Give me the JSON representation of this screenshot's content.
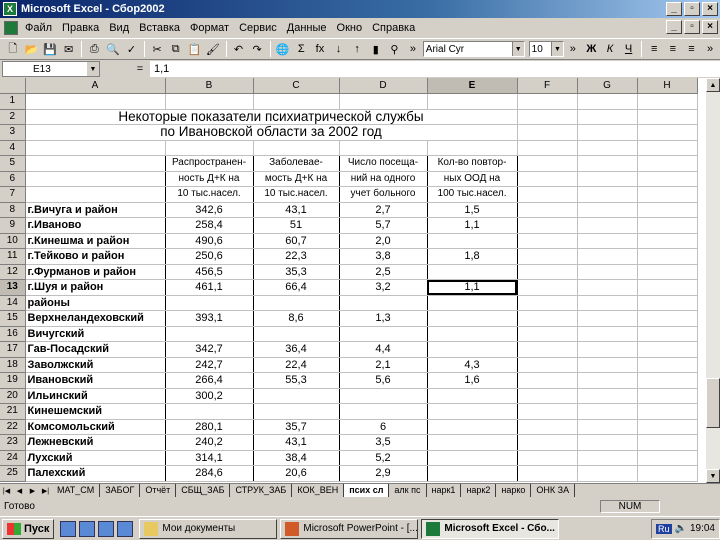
{
  "window": {
    "title": "Microsoft Excel - Сбор2002"
  },
  "menu": [
    "Файл",
    "Правка",
    "Вид",
    "Вставка",
    "Формат",
    "Сервис",
    "Данные",
    "Окно",
    "Справка"
  ],
  "toolbar": {
    "font_name": "Arial Cyr",
    "font_size": "10",
    "bold": "Ж",
    "italic": "К",
    "underline": "Ч",
    "sum": "Σ",
    "fx": "fx"
  },
  "formula_bar": {
    "cell_ref": "E13",
    "equals": "=",
    "value": "1,1"
  },
  "columns": [
    "A",
    "B",
    "C",
    "D",
    "E",
    "F",
    "G",
    "H"
  ],
  "sheet": {
    "title_line1": "Некоторые показатели психиатрической службы",
    "title_line2": "по Ивановской области за 2002 год",
    "headers": {
      "b": [
        "Распространен-",
        "ность Д+К на",
        "10 тыс.насел."
      ],
      "c": [
        "Заболевае-",
        "мость Д+К на",
        "10 тыс.насел."
      ],
      "d": [
        "Число посеща-",
        "ний на одного",
        "учет больного"
      ],
      "e": [
        "Кол-во повтор-",
        "ных ООД на",
        "100 тыс.насел."
      ]
    },
    "rows": [
      {
        "n": "8",
        "a": "г.Вичуга и район",
        "b": "342,6",
        "c": "43,1",
        "d": "2,7",
        "e": "1,5"
      },
      {
        "n": "9",
        "a": "г.Иваново",
        "b": "258,4",
        "c": "51",
        "d": "5,7",
        "e": "1,1"
      },
      {
        "n": "10",
        "a": "г.Кинешма и район",
        "b": "490,6",
        "c": "60,7",
        "d": "2,0",
        "e": ""
      },
      {
        "n": "11",
        "a": "г.Тейково и район",
        "b": "250,6",
        "c": "22,3",
        "d": "3,8",
        "e": "1,8"
      },
      {
        "n": "12",
        "a": "г.Фурманов и район",
        "b": "456,5",
        "c": "35,3",
        "d": "2,5",
        "e": ""
      },
      {
        "n": "13",
        "a": "г.Шуя и район",
        "b": "461,1",
        "c": "66,4",
        "d": "3,2",
        "e": "1,1"
      },
      {
        "n": "14",
        "a": "   районы",
        "b": "",
        "c": "",
        "d": "",
        "e": ""
      },
      {
        "n": "15",
        "a": "Верхнеландеховский",
        "b": "393,1",
        "c": "8,6",
        "d": "1,3",
        "e": ""
      },
      {
        "n": "16",
        "a": "Вичугский",
        "b": "",
        "c": "",
        "d": "",
        "e": ""
      },
      {
        "n": "17",
        "a": "Гав-Посадский",
        "b": "342,7",
        "c": "36,4",
        "d": "4,4",
        "e": ""
      },
      {
        "n": "18",
        "a": "Заволжский",
        "b": "242,7",
        "c": "22,4",
        "d": "2,1",
        "e": "4,3"
      },
      {
        "n": "19",
        "a": "Ивановский",
        "b": "266,4",
        "c": "55,3",
        "d": "5,6",
        "e": "1,6"
      },
      {
        "n": "20",
        "a": "Ильинский",
        "b": "300,2",
        "c": "",
        "d": "",
        "e": ""
      },
      {
        "n": "21",
        "a": "Кинешемский",
        "b": "",
        "c": "",
        "d": "",
        "e": ""
      },
      {
        "n": "22",
        "a": "Комсомольский",
        "b": "280,1",
        "c": "35,7",
        "d": "6",
        "e": ""
      },
      {
        "n": "23",
        "a": "Лежневский",
        "b": "240,2",
        "c": "43,1",
        "d": "3,5",
        "e": ""
      },
      {
        "n": "24",
        "a": "Лухский",
        "b": "314,1",
        "c": "38,4",
        "d": "5,2",
        "e": ""
      },
      {
        "n": "25",
        "a": "Палехский",
        "b": "284,6",
        "c": "20,6",
        "d": "2,9",
        "e": ""
      }
    ]
  },
  "tabs": [
    "МАТ_СМ",
    "ЗАБОГ",
    "Отчёт",
    "СБЩ_ЗАБ",
    "СТРУК_ЗАБ",
    "КОК_ВЕН",
    "псих сл",
    "алк пс",
    "нарк1",
    "нарк2",
    "нарко",
    "ОНК ЗА"
  ],
  "active_tab": "псих сл",
  "status": {
    "ready": "Готово",
    "num": "NUM"
  },
  "taskbar": {
    "start": "Пуск",
    "buttons": [
      "Мои документы",
      "Microsoft PowerPoint - [...",
      "Microsoft Excel - Сбо..."
    ],
    "lang": "Ru",
    "clock": "19:04"
  }
}
